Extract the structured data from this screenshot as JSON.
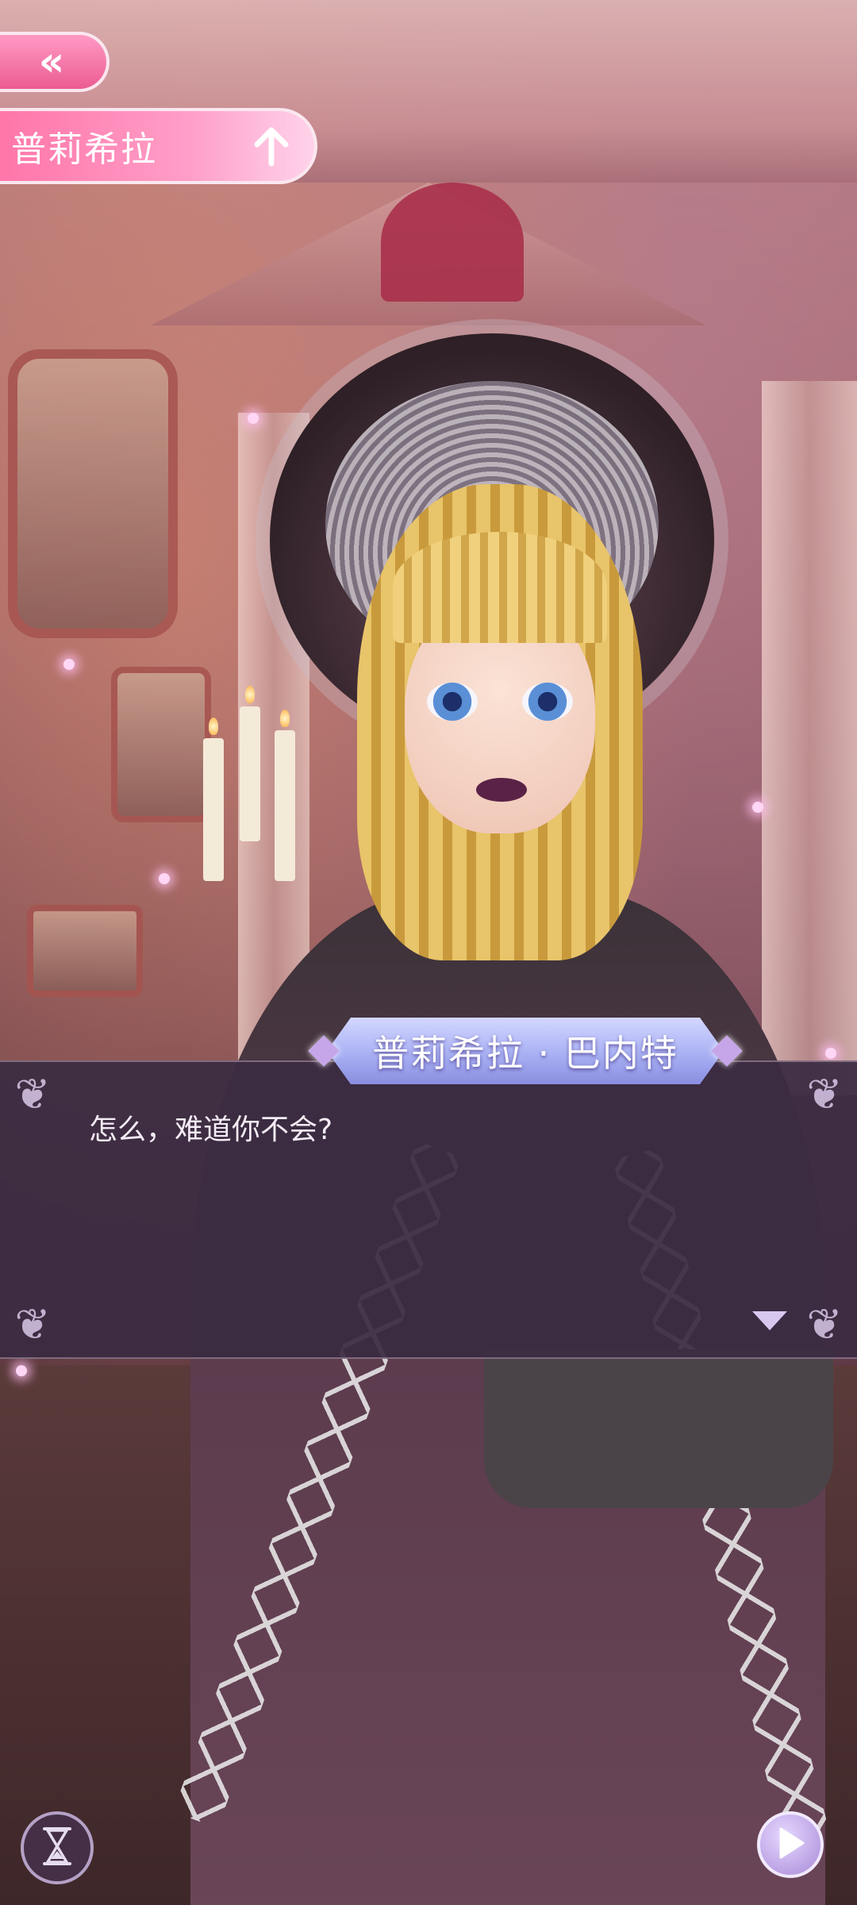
{
  "top_nav": {
    "back_icon": "double-chevron-left-icon",
    "character_selector_label": "普莉希拉",
    "character_selector_icon": "arrow-up-icon"
  },
  "dialogue": {
    "speaker_name": "普莉希拉 · 巴内特",
    "text": "怎么，难道你不会?",
    "continue_icon": "triangle-down-icon"
  },
  "bottom_controls": {
    "auto_icon": "hourglass-icon",
    "play_icon": "play-icon"
  },
  "colors": {
    "accent_pink": "#ec5c93",
    "dialog_bg": "#3a2b42",
    "name_plate": "#a9b1f4"
  }
}
